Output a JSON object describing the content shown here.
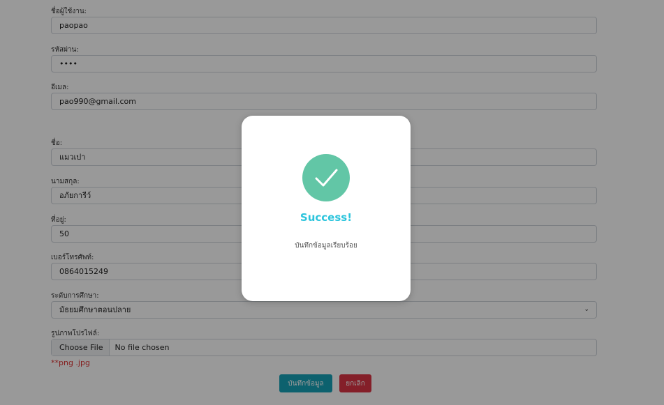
{
  "form": {
    "username": {
      "label": "ชื่อผู้ใช้งาน:",
      "value": "paopao"
    },
    "password": {
      "label": "รหัสผ่าน:",
      "value": "••••"
    },
    "email": {
      "label": "อีเมล:",
      "value": "pao990@gmail.com"
    },
    "firstname": {
      "label": "ชื่อ:",
      "value": "แมวเปา"
    },
    "lastname": {
      "label": "นามสกุล:",
      "value": "อภัยการีว์"
    },
    "address": {
      "label": "ที่อยู่:",
      "value": "50"
    },
    "phone": {
      "label": "เบอร์โทรศัพท์:",
      "value": "0864015249"
    },
    "education": {
      "label": "ระดับการศึกษา:",
      "value": "มัธยมศึกษาตอนปลาย"
    },
    "profile_image": {
      "label": "รูปภาพโปรไฟล์:",
      "button_label": "Choose File",
      "status_text": "No file chosen",
      "note": "**png .jpg"
    },
    "save_label": "บันทึกข้อมูล",
    "cancel_label": "ยกเลิก"
  },
  "modal": {
    "title": "Success!",
    "message": "บันทึกข้อมูลเรียบร้อย",
    "icon": "check-circle-icon"
  },
  "colors": {
    "overlay": "rgba(0,0,0,0.4)",
    "success_green": "#62c6a6",
    "success_title": "#2bc4dc",
    "save_button": "#17a2b8",
    "cancel_button": "#dc3545",
    "note_red": "#dd3333"
  }
}
